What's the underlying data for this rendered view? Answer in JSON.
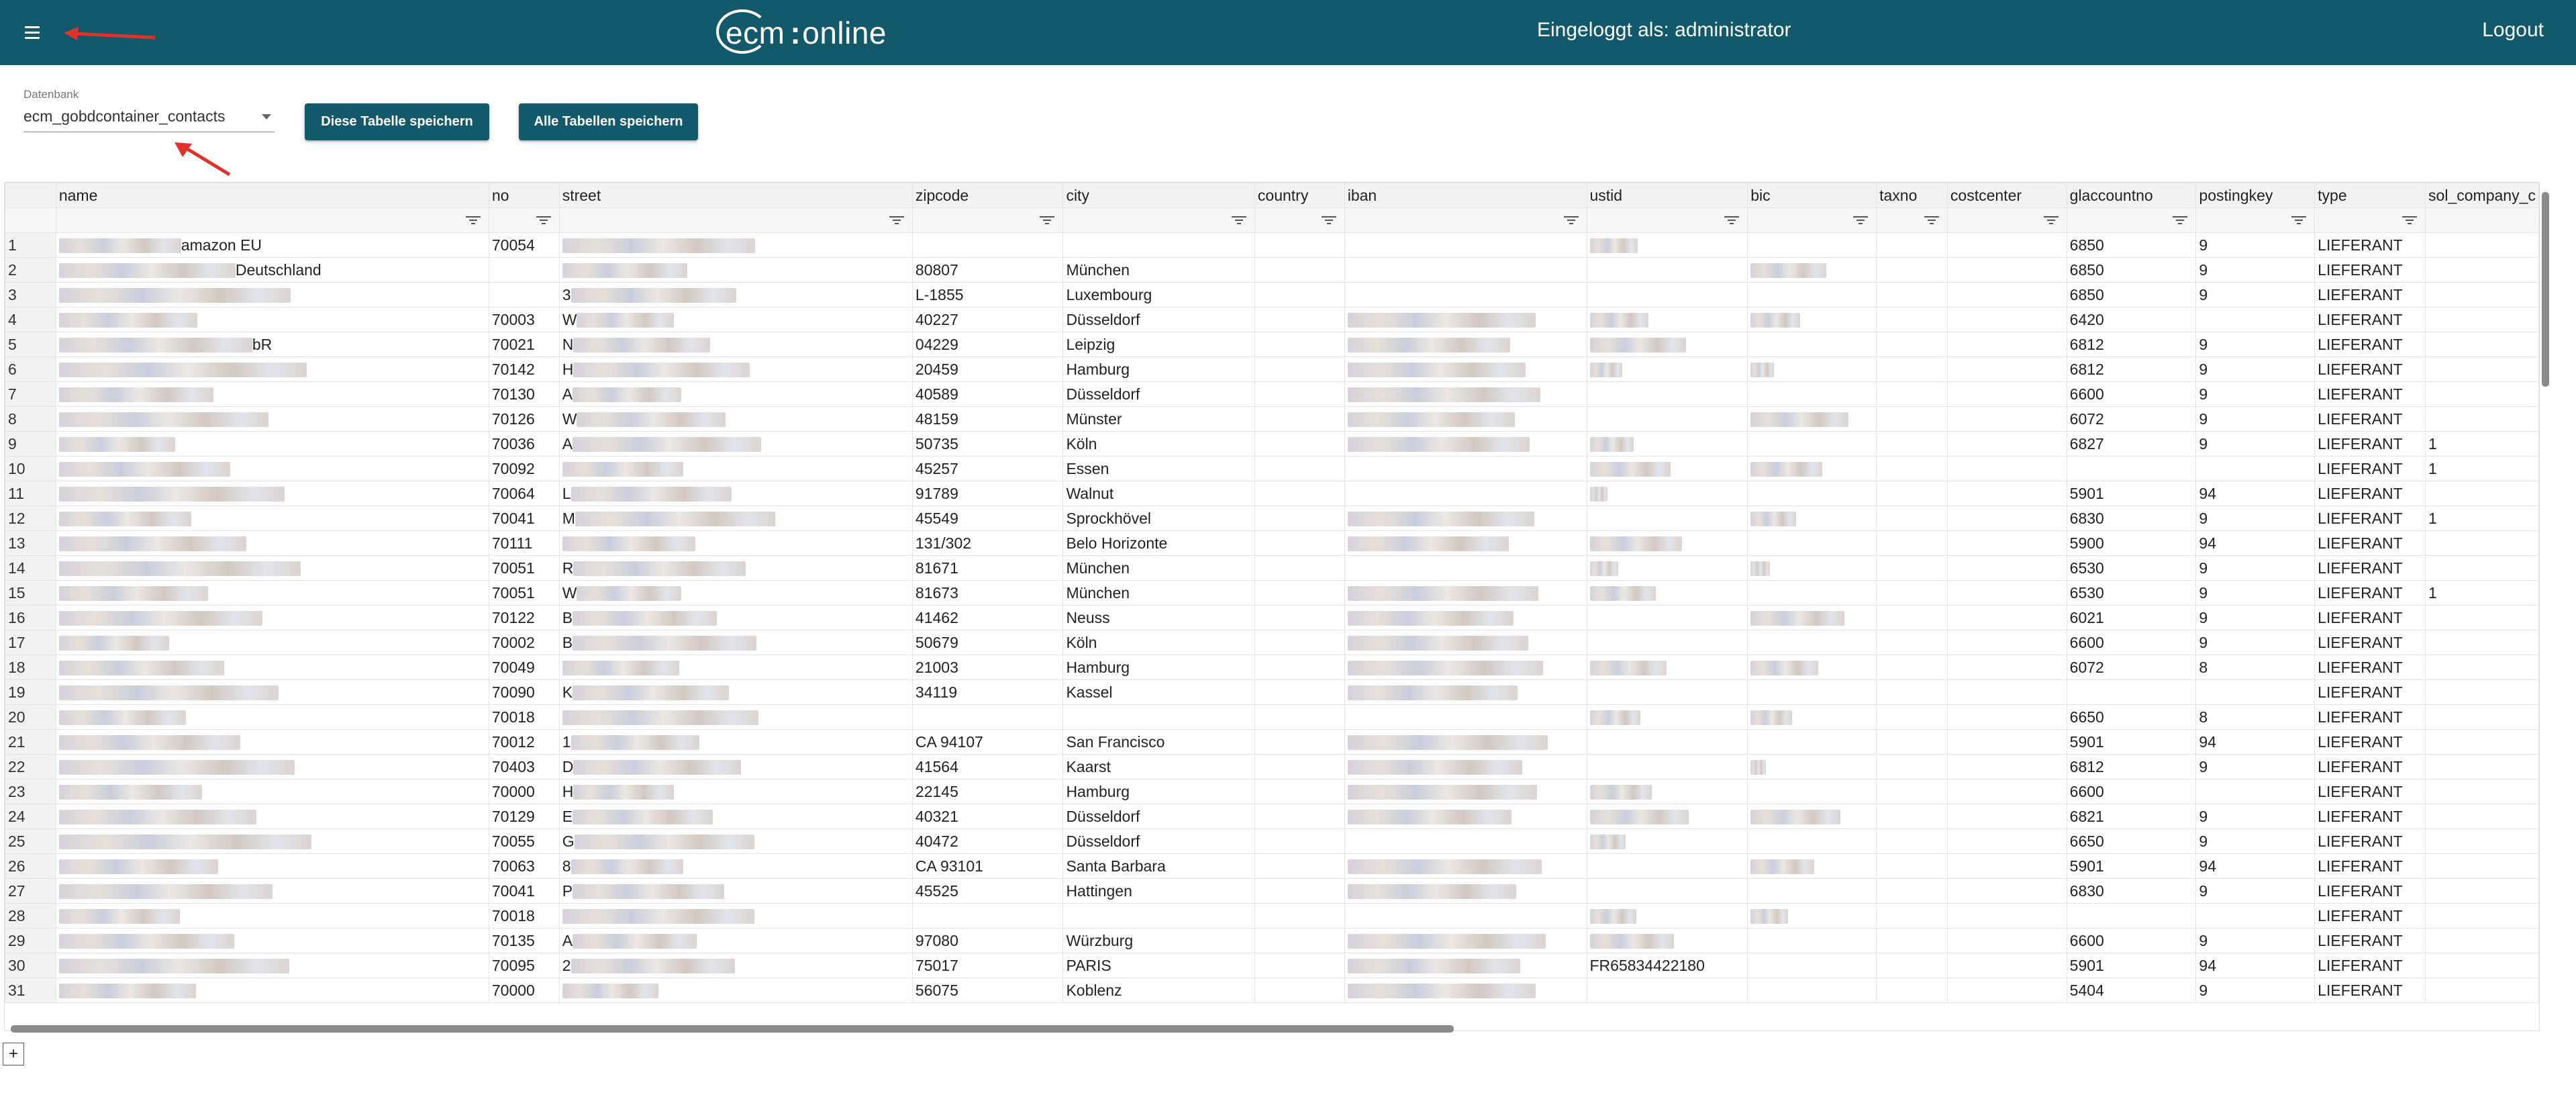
{
  "header": {
    "logo_ecm": "ecm",
    "logo_colon": ":",
    "logo_online": "online",
    "user_label": "Eingeloggt als: administrator",
    "logout_label": "Logout",
    "accent_color": "#11596b"
  },
  "toolbar": {
    "db_caption": "Datenbank",
    "db_value": "ecm_gobdcontainer_contacts",
    "save_table_label": "Diese Tabelle speichern",
    "save_all_label": "Alle Tabellen speichern"
  },
  "grid": {
    "columns": [
      "name",
      "no",
      "street",
      "zipcode",
      "city",
      "country",
      "iban",
      "ustid",
      "bic",
      "taxno",
      "costcenter",
      "glaccountno",
      "postingkey",
      "type",
      "sol_company_c"
    ],
    "rows": [
      {
        "n": "1",
        "name": "amazon EU",
        "no": "70054",
        "street": "",
        "zipcode": "",
        "city": "",
        "country": "",
        "iban": "",
        "ustid": "",
        "bic": "",
        "taxno": "",
        "costcenter": "",
        "glaccountno": "6850",
        "postingkey": "9",
        "type": "LIEFERANT",
        "sol": ""
      },
      {
        "n": "2",
        "name": "Deutschland",
        "no": "",
        "street": "",
        "zipcode": "80807",
        "city": "München",
        "country": "",
        "iban": "",
        "ustid": "",
        "bic": "",
        "taxno": "",
        "costcenter": "",
        "glaccountno": "6850",
        "postingkey": "9",
        "type": "LIEFERANT",
        "sol": ""
      },
      {
        "n": "3",
        "name": "",
        "no": "",
        "street": "3",
        "zipcode": "L-1855",
        "city": "Luxembourg",
        "country": "",
        "iban": "",
        "ustid": "",
        "bic": "",
        "taxno": "",
        "costcenter": "",
        "glaccountno": "6850",
        "postingkey": "9",
        "type": "LIEFERANT",
        "sol": ""
      },
      {
        "n": "4",
        "name": "",
        "no": "70003",
        "street": "W",
        "zipcode": "40227",
        "city": "Düsseldorf",
        "country": "",
        "iban": "",
        "ustid": "",
        "bic": "",
        "taxno": "",
        "costcenter": "",
        "glaccountno": "6420",
        "postingkey": "",
        "type": "LIEFERANT",
        "sol": ""
      },
      {
        "n": "5",
        "name": "bR",
        "no": "70021",
        "street": "N",
        "zipcode": "04229",
        "city": "Leipzig",
        "country": "",
        "iban": "",
        "ustid": "",
        "bic": "",
        "taxno": "",
        "costcenter": "",
        "glaccountno": "6812",
        "postingkey": "9",
        "type": "LIEFERANT",
        "sol": ""
      },
      {
        "n": "6",
        "name": "",
        "no": "70142",
        "street": "H",
        "zipcode": "20459",
        "city": "Hamburg",
        "country": "",
        "iban": "",
        "ustid": "",
        "bic": "",
        "taxno": "",
        "costcenter": "",
        "glaccountno": "6812",
        "postingkey": "9",
        "type": "LIEFERANT",
        "sol": ""
      },
      {
        "n": "7",
        "name": "",
        "no": "70130",
        "street": "A",
        "zipcode": "40589",
        "city": "Düsseldorf",
        "country": "",
        "iban": "",
        "ustid": "",
        "bic": "",
        "taxno": "",
        "costcenter": "",
        "glaccountno": "6600",
        "postingkey": "9",
        "type": "LIEFERANT",
        "sol": ""
      },
      {
        "n": "8",
        "name": "",
        "no": "70126",
        "street": "W",
        "zipcode": "48159",
        "city": "Münster",
        "country": "",
        "iban": "",
        "ustid": "",
        "bic": "",
        "taxno": "",
        "costcenter": "",
        "glaccountno": "6072",
        "postingkey": "9",
        "type": "LIEFERANT",
        "sol": ""
      },
      {
        "n": "9",
        "name": "",
        "no": "70036",
        "street": "A",
        "zipcode": "50735",
        "city": "Köln",
        "country": "",
        "iban": "",
        "ustid": "",
        "bic": "",
        "taxno": "",
        "costcenter": "",
        "glaccountno": "6827",
        "postingkey": "9",
        "type": "LIEFERANT",
        "sol": "1"
      },
      {
        "n": "10",
        "name": "",
        "no": "70092",
        "street": "",
        "zipcode": "45257",
        "city": "Essen",
        "country": "",
        "iban": "",
        "ustid": "",
        "bic": "",
        "taxno": "",
        "costcenter": "",
        "glaccountno": "",
        "postingkey": "",
        "type": "LIEFERANT",
        "sol": "1"
      },
      {
        "n": "11",
        "name": "",
        "no": "70064",
        "street": "L",
        "zipcode": "91789",
        "city": "Walnut",
        "country": "",
        "iban": "",
        "ustid": "",
        "bic": "",
        "taxno": "",
        "costcenter": "",
        "glaccountno": "5901",
        "postingkey": "94",
        "type": "LIEFERANT",
        "sol": ""
      },
      {
        "n": "12",
        "name": "",
        "no": "70041",
        "street": "M",
        "zipcode": "45549",
        "city": "Sprockhövel",
        "country": "",
        "iban": "",
        "ustid": "",
        "bic": "",
        "taxno": "",
        "costcenter": "",
        "glaccountno": "6830",
        "postingkey": "9",
        "type": "LIEFERANT",
        "sol": "1"
      },
      {
        "n": "13",
        "name": "",
        "no": "70111",
        "street": "",
        "zipcode": "131/302",
        "city": "Belo Horizonte",
        "country": "",
        "iban": "",
        "ustid": "",
        "bic": "",
        "taxno": "",
        "costcenter": "",
        "glaccountno": "5900",
        "postingkey": "94",
        "type": "LIEFERANT",
        "sol": ""
      },
      {
        "n": "14",
        "name": "",
        "no": "70051",
        "street": "R",
        "zipcode": "81671",
        "city": "München",
        "country": "",
        "iban": "",
        "ustid": "",
        "bic": "",
        "taxno": "",
        "costcenter": "",
        "glaccountno": "6530",
        "postingkey": "9",
        "type": "LIEFERANT",
        "sol": ""
      },
      {
        "n": "15",
        "name": "",
        "no": "70051",
        "street": "W",
        "zipcode": "81673",
        "city": "München",
        "country": "",
        "iban": "",
        "ustid": "",
        "bic": "",
        "taxno": "",
        "costcenter": "",
        "glaccountno": "6530",
        "postingkey": "9",
        "type": "LIEFERANT",
        "sol": "1"
      },
      {
        "n": "16",
        "name": "",
        "no": "70122",
        "street": "B",
        "zipcode": "41462",
        "city": "Neuss",
        "country": "",
        "iban": "",
        "ustid": "",
        "bic": "",
        "taxno": "",
        "costcenter": "",
        "glaccountno": "6021",
        "postingkey": "9",
        "type": "LIEFERANT",
        "sol": ""
      },
      {
        "n": "17",
        "name": "",
        "no": "70002",
        "street": "B",
        "zipcode": "50679",
        "city": "Köln",
        "country": "",
        "iban": "",
        "ustid": "",
        "bic": "",
        "taxno": "",
        "costcenter": "",
        "glaccountno": "6600",
        "postingkey": "9",
        "type": "LIEFERANT",
        "sol": ""
      },
      {
        "n": "18",
        "name": "",
        "no": "70049",
        "street": "",
        "zipcode": "21003",
        "city": "Hamburg",
        "country": "",
        "iban": "",
        "ustid": "",
        "bic": "",
        "taxno": "",
        "costcenter": "",
        "glaccountno": "6072",
        "postingkey": "8",
        "type": "LIEFERANT",
        "sol": ""
      },
      {
        "n": "19",
        "name": "",
        "no": "70090",
        "street": "K",
        "zipcode": "34119",
        "city": "Kassel",
        "country": "",
        "iban": "",
        "ustid": "",
        "bic": "",
        "taxno": "",
        "costcenter": "",
        "glaccountno": "",
        "postingkey": "",
        "type": "LIEFERANT",
        "sol": ""
      },
      {
        "n": "20",
        "name": "",
        "no": "70018",
        "street": "",
        "zipcode": "",
        "city": "",
        "country": "",
        "iban": "",
        "ustid": "",
        "bic": "",
        "taxno": "",
        "costcenter": "",
        "glaccountno": "6650",
        "postingkey": "8",
        "type": "LIEFERANT",
        "sol": ""
      },
      {
        "n": "21",
        "name": "",
        "no": "70012",
        "street": "1",
        "zipcode": "CA 94107",
        "city": "San Francisco",
        "country": "",
        "iban": "",
        "ustid": "",
        "bic": "",
        "taxno": "",
        "costcenter": "",
        "glaccountno": "5901",
        "postingkey": "94",
        "type": "LIEFERANT",
        "sol": ""
      },
      {
        "n": "22",
        "name": "",
        "no": "70403",
        "street": "D",
        "zipcode": "41564",
        "city": "Kaarst",
        "country": "",
        "iban": "",
        "ustid": "",
        "bic": "",
        "taxno": "",
        "costcenter": "",
        "glaccountno": "6812",
        "postingkey": "9",
        "type": "LIEFERANT",
        "sol": ""
      },
      {
        "n": "23",
        "name": "",
        "no": "70000",
        "street": "H",
        "zipcode": "22145",
        "city": "Hamburg",
        "country": "",
        "iban": "",
        "ustid": "",
        "bic": "",
        "taxno": "",
        "costcenter": "",
        "glaccountno": "6600",
        "postingkey": "",
        "type": "LIEFERANT",
        "sol": ""
      },
      {
        "n": "24",
        "name": "",
        "no": "70129",
        "street": "E",
        "zipcode": "40321",
        "city": "Düsseldorf",
        "country": "",
        "iban": "",
        "ustid": "",
        "bic": "",
        "taxno": "",
        "costcenter": "",
        "glaccountno": "6821",
        "postingkey": "9",
        "type": "LIEFERANT",
        "sol": ""
      },
      {
        "n": "25",
        "name": "",
        "no": "70055",
        "street": "G",
        "zipcode": "40472",
        "city": "Düsseldorf",
        "country": "",
        "iban": "",
        "ustid": "",
        "bic": "",
        "taxno": "",
        "costcenter": "",
        "glaccountno": "6650",
        "postingkey": "9",
        "type": "LIEFERANT",
        "sol": ""
      },
      {
        "n": "26",
        "name": "",
        "no": "70063",
        "street": "8",
        "zipcode": "CA 93101",
        "city": "Santa Barbara",
        "country": "",
        "iban": "",
        "ustid": "",
        "bic": "",
        "taxno": "",
        "costcenter": "",
        "glaccountno": "5901",
        "postingkey": "94",
        "type": "LIEFERANT",
        "sol": ""
      },
      {
        "n": "27",
        "name": "",
        "no": "70041",
        "street": "P",
        "zipcode": "45525",
        "city": "Hattingen",
        "country": "",
        "iban": "",
        "ustid": "",
        "bic": "",
        "taxno": "",
        "costcenter": "",
        "glaccountno": "6830",
        "postingkey": "9",
        "type": "LIEFERANT",
        "sol": ""
      },
      {
        "n": "28",
        "name": "",
        "no": "70018",
        "street": "",
        "zipcode": "",
        "city": "",
        "country": "",
        "iban": "",
        "ustid": "",
        "bic": "",
        "taxno": "",
        "costcenter": "",
        "glaccountno": "",
        "postingkey": "",
        "type": "LIEFERANT",
        "sol": ""
      },
      {
        "n": "29",
        "name": "",
        "no": "70135",
        "street": "A",
        "zipcode": "97080",
        "city": "Würzburg",
        "country": "",
        "iban": "",
        "ustid": "",
        "bic": "",
        "taxno": "",
        "costcenter": "",
        "glaccountno": "6600",
        "postingkey": "9",
        "type": "LIEFERANT",
        "sol": ""
      },
      {
        "n": "30",
        "name": "",
        "no": "70095",
        "street": "2",
        "zipcode": "75017",
        "city": "PARIS",
        "country": "",
        "iban": "",
        "ustid": "FR65834422180",
        "bic": "",
        "taxno": "",
        "costcenter": "",
        "glaccountno": "5901",
        "postingkey": "94",
        "type": "LIEFERANT",
        "sol": ""
      },
      {
        "n": "31",
        "name": "",
        "no": "70000",
        "street": "",
        "zipcode": "56075",
        "city": "Koblenz",
        "country": "",
        "iban": "",
        "ustid": "",
        "bic": "",
        "taxno": "",
        "costcenter": "",
        "glaccountno": "5404",
        "postingkey": "9",
        "type": "LIEFERANT",
        "sol": ""
      }
    ],
    "add_row_label": "+"
  }
}
